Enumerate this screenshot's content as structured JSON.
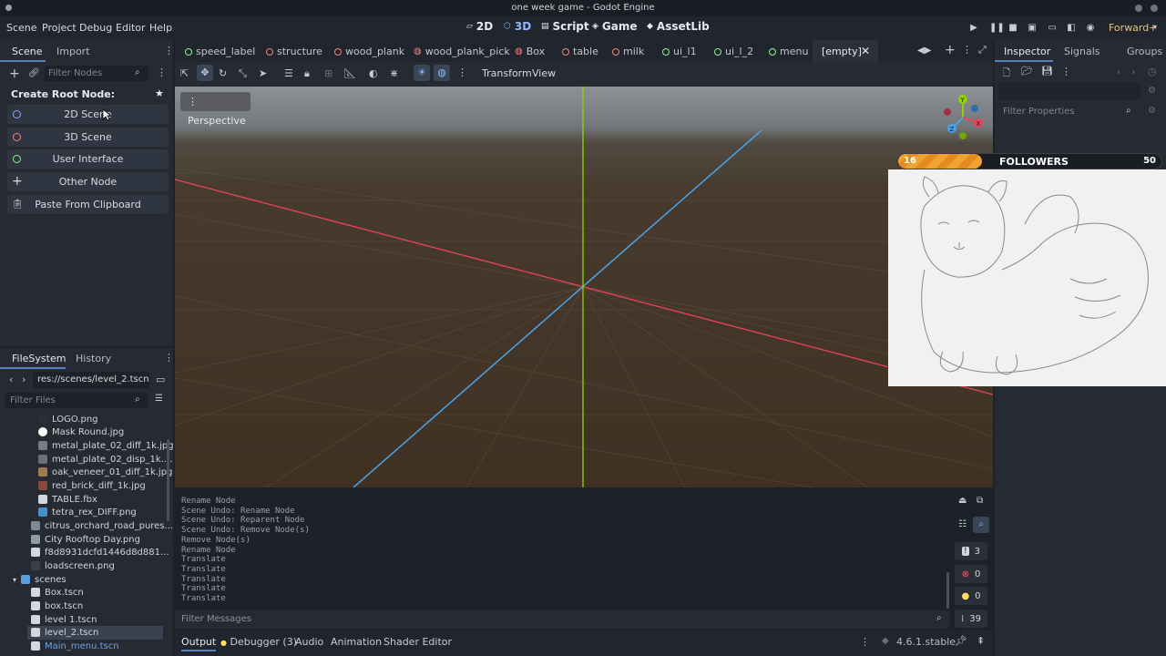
{
  "window": {
    "title": "one week game - Godot Engine"
  },
  "menu": [
    "Scene",
    "Project",
    "Debug",
    "Editor",
    "Help"
  ],
  "workspaces": [
    {
      "label": "2D",
      "icon": "2d-icon"
    },
    {
      "label": "3D",
      "icon": "3d-icon",
      "active": true
    },
    {
      "label": "Script",
      "icon": "script-icon"
    },
    {
      "label": "Game",
      "icon": "game-icon"
    },
    {
      "label": "AssetLib",
      "icon": "assetlib-icon"
    }
  ],
  "renderer": "Forward+",
  "scene_dock": {
    "tabs": [
      "Scene",
      "Import"
    ],
    "filter_placeholder": "Filter Nodes",
    "create_root_label": "Create Root Node:",
    "buttons": [
      {
        "label": "2D Scene",
        "color": "#8da5f3"
      },
      {
        "label": "3D Scene",
        "color": "#fc7f7f"
      },
      {
        "label": "User Interface",
        "color": "#8eef97"
      },
      {
        "label": "Other Node",
        "color": "#ffffff"
      },
      {
        "label": "Paste From Clipboard",
        "color": "#ffffff"
      }
    ]
  },
  "filesystem": {
    "tabs": [
      "FileSystem",
      "History"
    ],
    "path": "res://scenes/level_2.tscn",
    "filter_placeholder": "Filter Files",
    "items": [
      "LOGO.png",
      "Mask Round.jpg",
      "metal_plate_02_diff_1k.jpg",
      "metal_plate_02_disp_1k....",
      "oak_veneer_01_diff_1k.jpg",
      "red_brick_diff_1k.jpg",
      "TABLE.fbx",
      "tetra_rex_DIFF.png",
      "citrus_orchard_road_pures...",
      "City Rooftop Day.png",
      "f8d8931dcfd1446d8d881...",
      "loadscreen.png",
      "scenes",
      "Box.tscn",
      "box.tscn",
      "level 1.tscn",
      "level_2.tscn",
      "Main_menu.tscn"
    ]
  },
  "scene_tabs": [
    {
      "label": "speed_label",
      "color": "#8eef97"
    },
    {
      "label": "structure",
      "color": "#fc7f7f"
    },
    {
      "label": "wood_plank",
      "color": "#fc7f7f"
    },
    {
      "label": "wood_plank_pick",
      "color": "#fc7f7f"
    },
    {
      "label": "Box",
      "color": "#fc7f7f"
    },
    {
      "label": "table",
      "color": "#fc7f7f"
    },
    {
      "label": "milk",
      "color": "#fc7f7f"
    },
    {
      "label": "ui_l1",
      "color": "#8eef97"
    },
    {
      "label": "ui_l_2",
      "color": "#8eef97"
    },
    {
      "label": "menu",
      "color": "#8eef97"
    },
    {
      "label": "[empty]",
      "color": ""
    }
  ],
  "toolbar": {
    "transform": "Transform",
    "view": "View"
  },
  "viewport": {
    "perspective": "Perspective",
    "gizmo_labels": [
      "Y",
      "X",
      "Z"
    ]
  },
  "inspector": {
    "tabs": [
      "Inspector",
      "Signals",
      "Groups"
    ],
    "filter_placeholder": "Filter Properties"
  },
  "overlay": {
    "left_count": "16",
    "label": "FOLLOWERS",
    "right_count": "50",
    "progress": 0.32
  },
  "output": {
    "lines": [
      "Rename Node",
      "Scene Undo: Rename Node",
      "Scene Undo: Reparent Node",
      "Scene Undo: Remove Node(s)",
      "Remove Node(s)",
      "Rename Node",
      "Translate",
      "Translate",
      "Translate",
      "Translate",
      "Translate"
    ],
    "filter_placeholder": "Filter Messages",
    "counts": {
      "messages": "3",
      "errors": "0",
      "warnings": "0",
      "other": "39"
    }
  },
  "bottom_tabs": [
    "Output",
    "Debugger (3)",
    "Audio",
    "Animation",
    "Shader Editor"
  ],
  "version": "4.6.1.stable"
}
